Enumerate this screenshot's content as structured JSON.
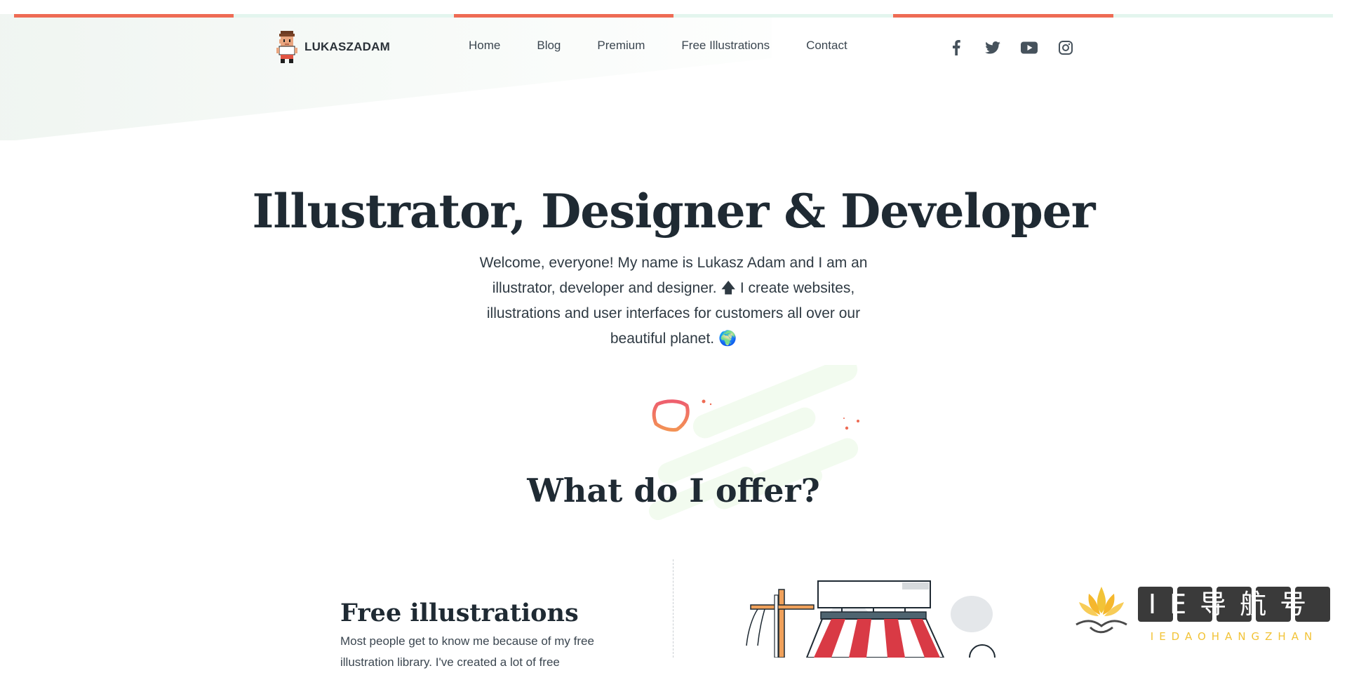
{
  "brand": {
    "name": "LUKASZADAM"
  },
  "nav": {
    "items": [
      "Home",
      "Blog",
      "Premium",
      "Free Illustrations",
      "Contact"
    ]
  },
  "social": {
    "icons": [
      "facebook-icon",
      "twitter-icon",
      "youtube-icon",
      "instagram-icon"
    ]
  },
  "hero": {
    "title": "Illustrator, Designer & Developer",
    "text": "Welcome, everyone! My name is Lukasz Adam and I am an illustrator, developer and designer. 🡅 I create websites, illustrations and user interfaces for customers all over our beautiful planet. 🌍"
  },
  "offer": {
    "title": "What do I offer?",
    "card": {
      "title": "Free illustrations",
      "text": "Most people get to know me because of my free illustration library. I've created a lot of free"
    }
  },
  "watermark": {
    "main": "IE导航号",
    "sub": "IEDAOHANGZHAN"
  },
  "colors": {
    "accent": "#ee6b54",
    "mint": "#e3f5ee",
    "text": "#1f2a33"
  }
}
